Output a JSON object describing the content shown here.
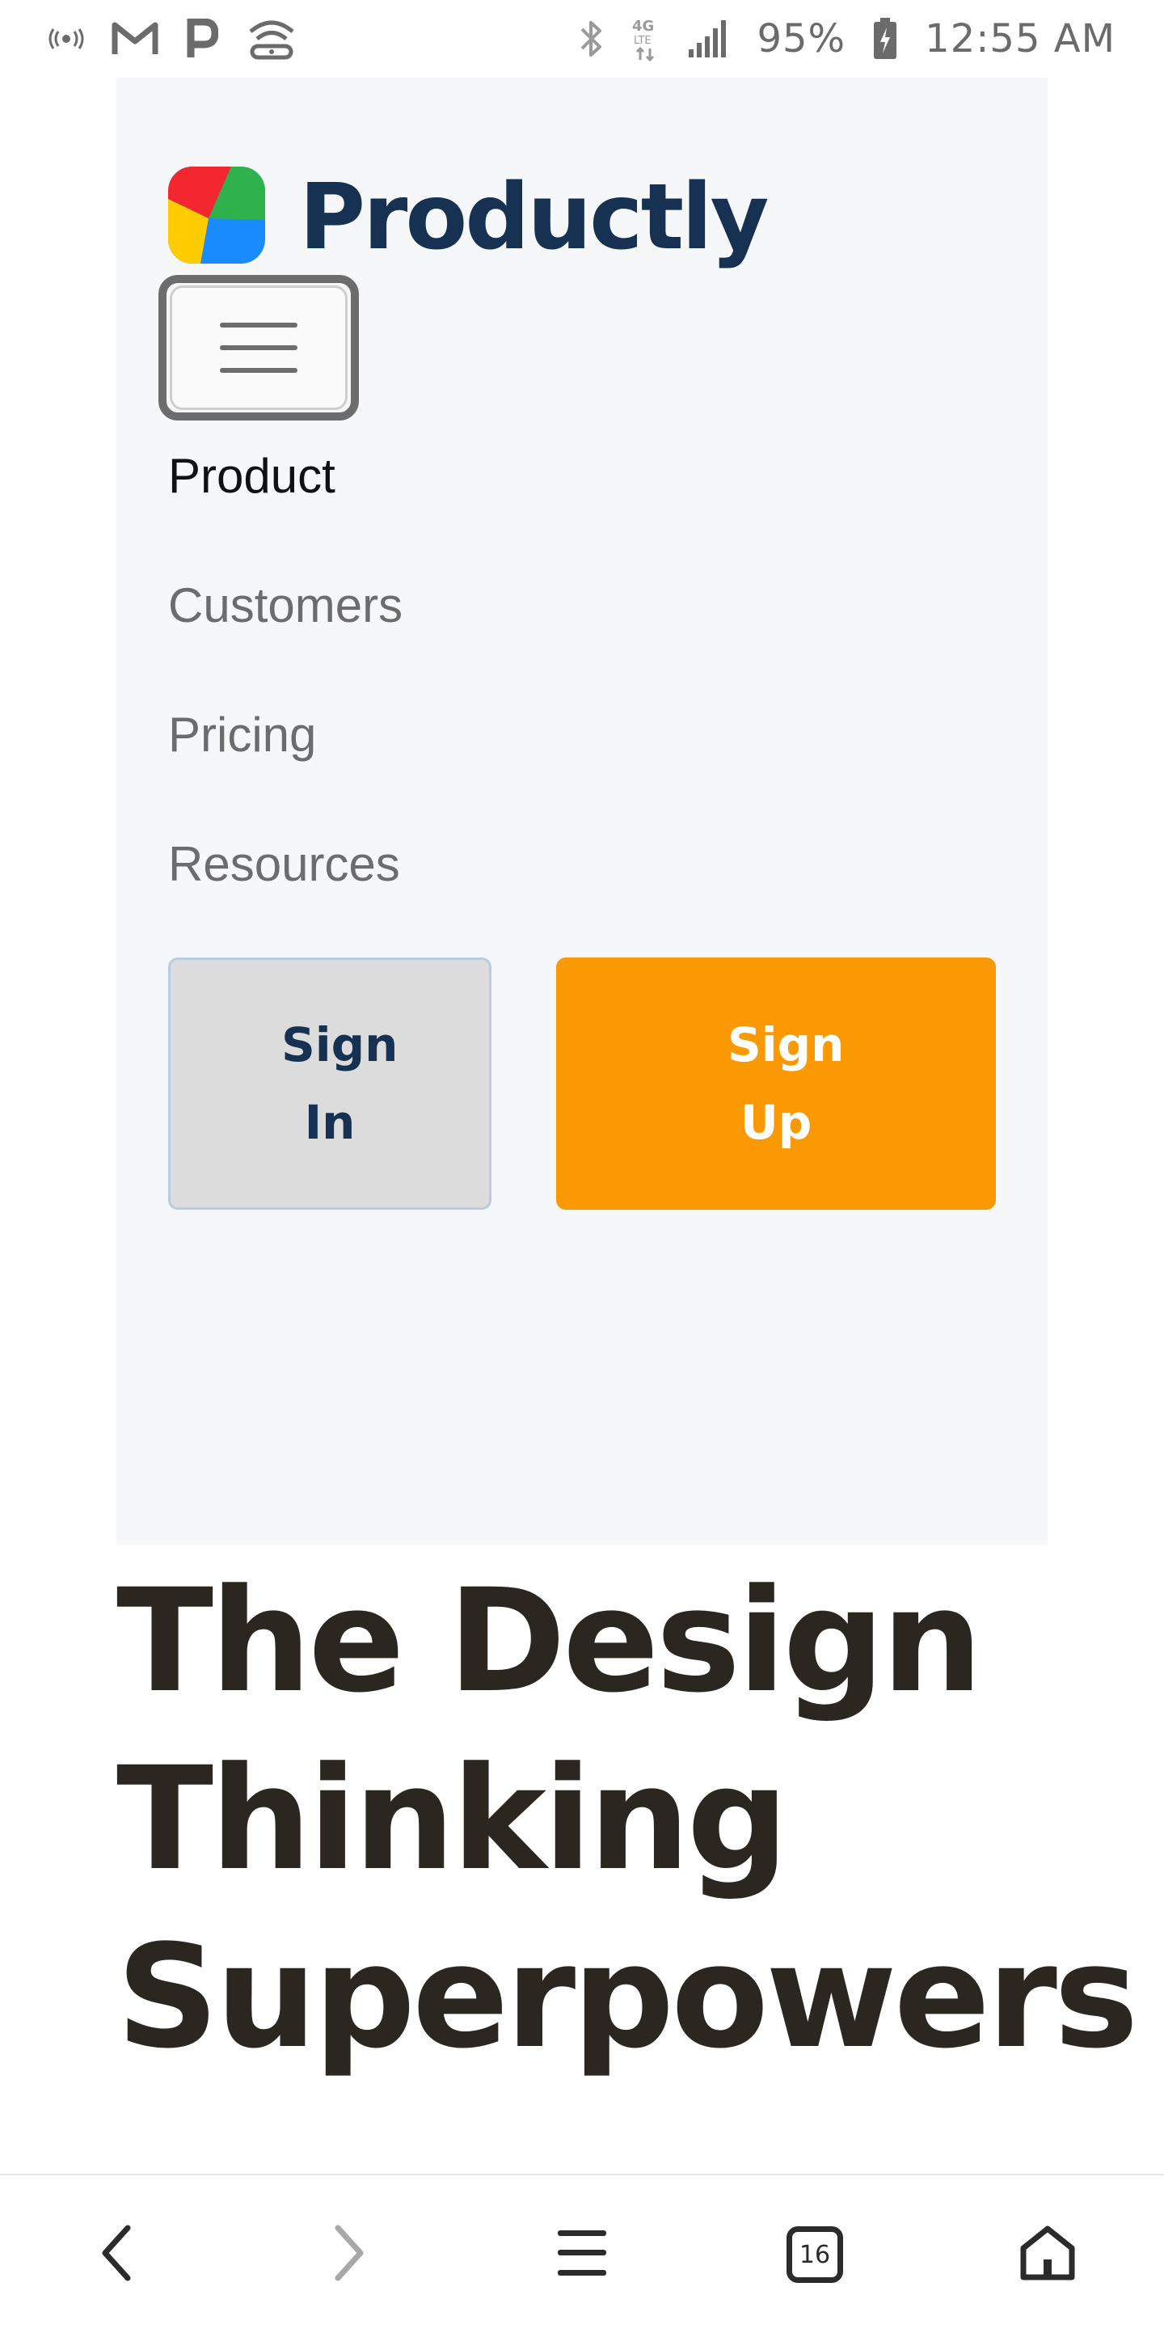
{
  "status_bar": {
    "icons_left": [
      "nfc-icon",
      "gmail-icon",
      "parking-icon",
      "wifi-hotspot-icon"
    ],
    "icons_right": [
      "bluetooth-icon",
      "4g-lte-icon",
      "signal-icon",
      "battery-charging-icon"
    ],
    "battery": "95%",
    "time": "12:55 AM"
  },
  "brand": {
    "name": "Productly",
    "logo_colors": [
      "#f4262f",
      "#2fb24c",
      "#1a8cff",
      "#ffcc00"
    ]
  },
  "nav": {
    "links": [
      {
        "label": "Product",
        "active": true
      },
      {
        "label": "Customers",
        "active": false
      },
      {
        "label": "Pricing",
        "active": false
      },
      {
        "label": "Resources",
        "active": false
      }
    ],
    "sign_in": {
      "line1": "Sign",
      "line2": "In"
    },
    "sign_up": {
      "line1": "Sign",
      "line2": "Up"
    }
  },
  "hero": {
    "title_lines": [
      "The Design",
      "Thinking",
      "Superpowers"
    ]
  },
  "browser_bar": {
    "tab_count": "16",
    "icons": [
      "back-icon",
      "forward-icon",
      "menu-icon",
      "tabs-icon",
      "home-icon"
    ]
  },
  "colors": {
    "brand_navy": "#173152",
    "accent_orange": "#fb9904",
    "panel_bg": "#f6f7f9",
    "hero_text": "#2c2620"
  }
}
